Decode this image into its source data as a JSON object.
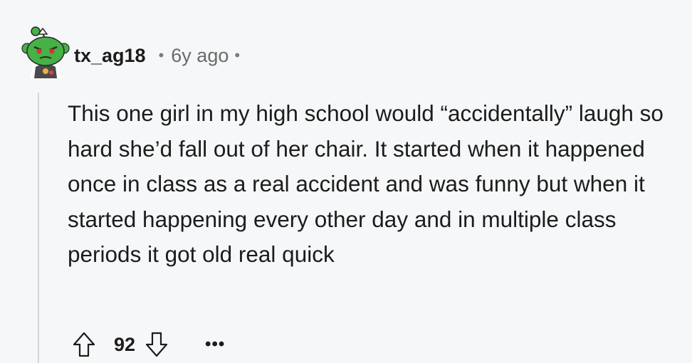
{
  "comment": {
    "username": "tx_ag18",
    "separator": "•",
    "age": "6y ago",
    "body": "This one girl in my high school would “accidentally” laugh so hard she’d fall out of her chair. It started when it happened once in class as a real accident and was funny but when it started happening every other day and in multiple class periods it got old real quick",
    "score": "92",
    "more_label": "•••"
  },
  "icons": {
    "avatar": "snoo-avatar",
    "upvote": "upvote-arrow-icon",
    "downvote": "downvote-arrow-icon",
    "more": "more-options-icon"
  },
  "colors": {
    "background": "#f6f7f8",
    "text": "#1c1c1c",
    "meta": "#6a6a6a",
    "thread_line": "#d4d6d8",
    "avatar_green": "#46b146"
  }
}
